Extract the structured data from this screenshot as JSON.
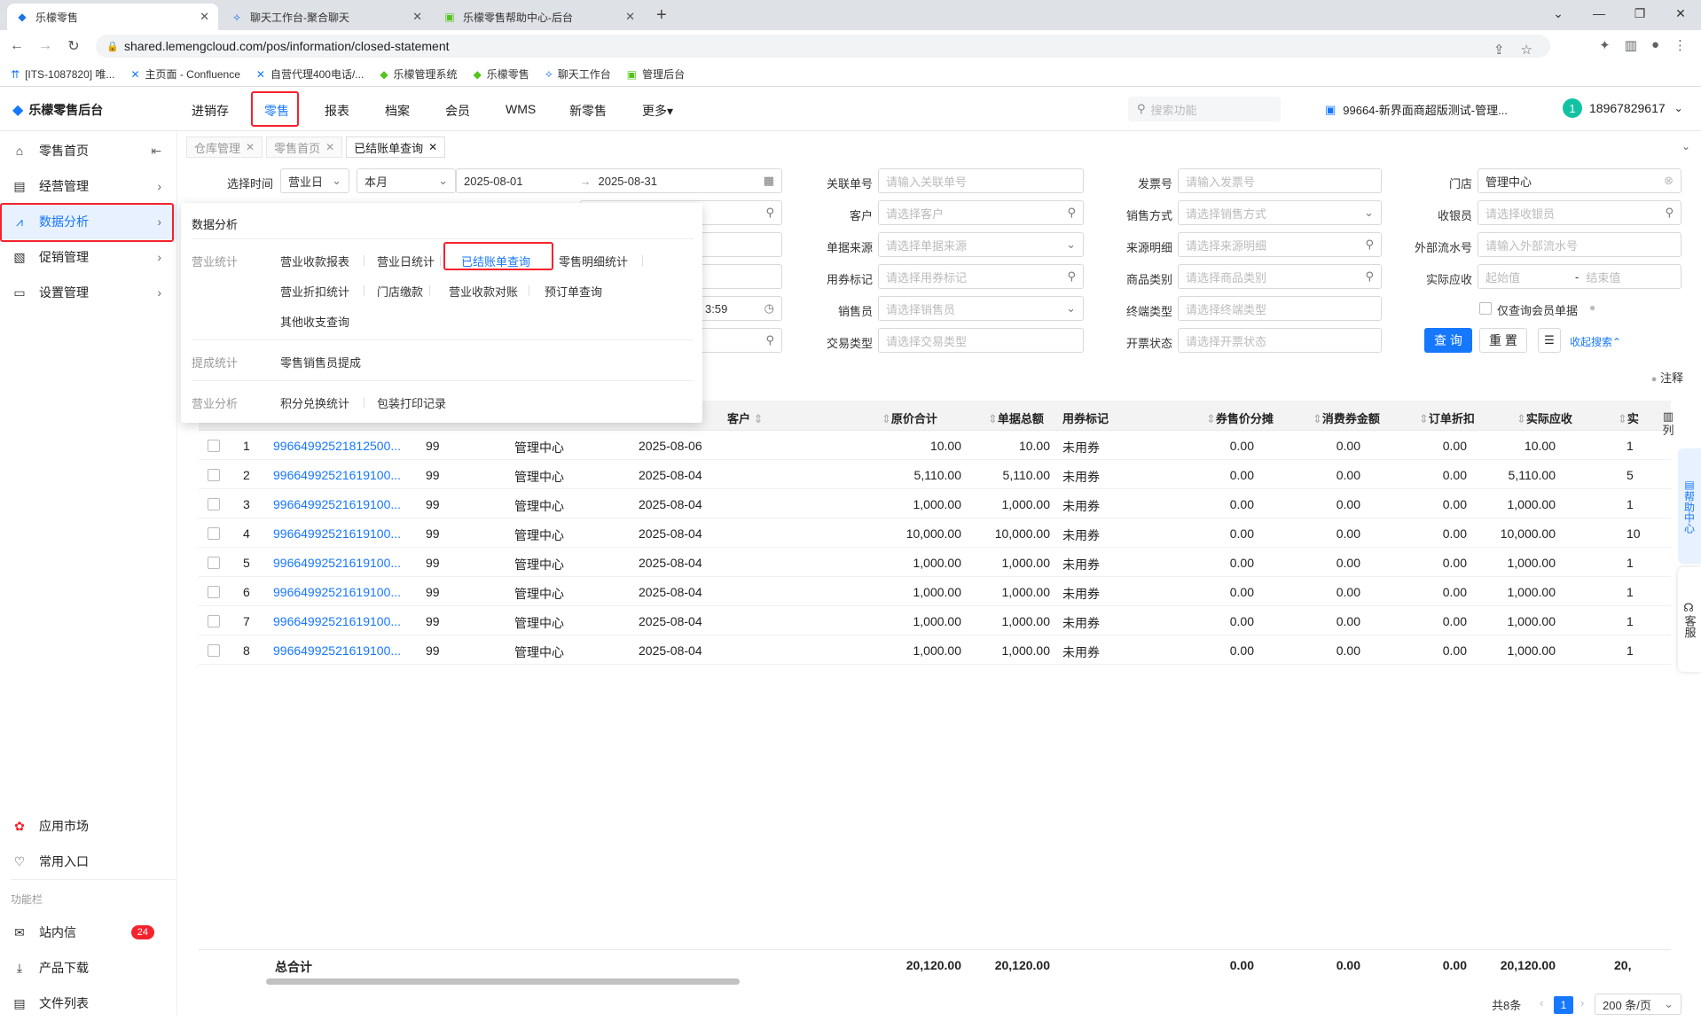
{
  "browser": {
    "tabs": [
      {
        "label": "乐檬零售"
      },
      {
        "label": "聊天工作台-聚合聊天"
      },
      {
        "label": "乐檬零售帮助中心-后台"
      }
    ],
    "url": "shared.lemengcloud.com/pos/information/closed-statement",
    "bookmarks": [
      {
        "label": "[ITS-1087820] 唯..."
      },
      {
        "label": "主页面 - Confluence"
      },
      {
        "label": "自营代理400电话/..."
      },
      {
        "label": "乐檬管理系统"
      },
      {
        "label": "乐檬零售"
      },
      {
        "label": "聊天工作台"
      },
      {
        "label": "管理后台"
      }
    ]
  },
  "header": {
    "logo": "乐檬零售后台",
    "menu": [
      {
        "label": "进销存"
      },
      {
        "label": "零售"
      },
      {
        "label": "报表"
      },
      {
        "label": "档案"
      },
      {
        "label": "会员"
      },
      {
        "label": "WMS"
      },
      {
        "label": "新零售"
      },
      {
        "label": "更多▾"
      }
    ],
    "search_placeholder": "搜索功能",
    "store": "99664-新界面商超版测试-管理...",
    "avatar_text": "1",
    "user": "18967829617"
  },
  "sidebar": {
    "items": [
      {
        "label": "零售首页"
      },
      {
        "label": "经营管理"
      },
      {
        "label": "数据分析"
      },
      {
        "label": "促销管理"
      },
      {
        "label": "设置管理"
      }
    ],
    "bottom": [
      {
        "label": "应用市场"
      },
      {
        "label": "常用入口"
      }
    ],
    "func_label": "功能栏",
    "func": [
      {
        "label": "站内信"
      },
      {
        "label": "产品下载"
      },
      {
        "label": "文件列表"
      }
    ],
    "badge": "24"
  },
  "pagetabs": [
    {
      "label": "仓库管理"
    },
    {
      "label": "零售首页"
    },
    {
      "label": "已结账单查询"
    }
  ],
  "filters": {
    "select_time": "选择时间",
    "biz_day": "营业日",
    "period": "本月",
    "date_start": "2025-08-01",
    "date_end": "2025-08-31",
    "time_partial": "3:59",
    "labels": {
      "rel_no": "关联单号",
      "invoice": "发票号",
      "store": "门店",
      "customer": "客户",
      "sale_mode": "销售方式",
      "cashier": "收银员",
      "source": "单据来源",
      "source_detail": "来源明细",
      "ext_serial": "外部流水号",
      "coupon": "用券标记",
      "category": "商品类别",
      "receivable": "实际应收",
      "salesman": "销售员",
      "terminal": "终端类型",
      "trade_type": "交易类型",
      "invoice_status": "开票状态"
    },
    "placeholders": {
      "rel_no": "请输入关联单号",
      "invoice": "请输入发票号",
      "customer": "请选择客户",
      "sale_mode": "请选择销售方式",
      "cashier": "请选择收银员",
      "source": "请选择单据来源",
      "source_detail": "请选择来源明细",
      "ext_serial": "请输入外部流水号",
      "coupon": "请选择用券标记",
      "category": "请选择商品类别",
      "min": "起始值",
      "max": "结束值",
      "salesman": "请选择销售员",
      "terminal": "请选择终端类型",
      "trade_type": "请选择交易类型",
      "invoice_status": "请选择开票状态"
    },
    "store_value": "管理中心",
    "member_only": "仅查询会员单据",
    "query": "查 询",
    "reset": "重 置",
    "collapse": "收起搜索",
    "note": "注释"
  },
  "dropdown": {
    "title": "数据分析",
    "sec1": "营业统计",
    "links1": [
      "营业收款报表",
      "营业日统计",
      "已结账单查询",
      "零售明细统计",
      "营业折扣统计",
      "门店缴款",
      "营业收款对账",
      "预订单查询",
      "其他收支查询"
    ],
    "sec2": "提成统计",
    "links2": [
      "零售销售员提成"
    ],
    "sec3": "营业分析",
    "links3": [
      "积分兑换统计",
      "包装打印记录"
    ]
  },
  "table": {
    "headers": [
      "客户",
      "原价合计",
      "单据总额",
      "用券标记",
      "券售价分摊",
      "消费券金额",
      "订单折扣",
      "实际应收",
      "实"
    ],
    "col_btn": "列",
    "rows": [
      {
        "idx": "1",
        "no": "99664992521812500...",
        "c3": "99",
        "store": "管理中心",
        "date": "2025-08-06",
        "orig": "10.00",
        "total": "10.00",
        "coupon": "未用券",
        "share": "0.00",
        "voucher": "0.00",
        "disc": "0.00",
        "recv": "10.00",
        "last": "1"
      },
      {
        "idx": "2",
        "no": "99664992521619100...",
        "c3": "99",
        "store": "管理中心",
        "date": "2025-08-04",
        "orig": "5,110.00",
        "total": "5,110.00",
        "coupon": "未用券",
        "share": "0.00",
        "voucher": "0.00",
        "disc": "0.00",
        "recv": "5,110.00",
        "last": "5"
      },
      {
        "idx": "3",
        "no": "99664992521619100...",
        "c3": "99",
        "store": "管理中心",
        "date": "2025-08-04",
        "orig": "1,000.00",
        "total": "1,000.00",
        "coupon": "未用券",
        "share": "0.00",
        "voucher": "0.00",
        "disc": "0.00",
        "recv": "1,000.00",
        "last": "1"
      },
      {
        "idx": "4",
        "no": "99664992521619100...",
        "c3": "99",
        "store": "管理中心",
        "date": "2025-08-04",
        "orig": "10,000.00",
        "total": "10,000.00",
        "coupon": "未用券",
        "share": "0.00",
        "voucher": "0.00",
        "disc": "0.00",
        "recv": "10,000.00",
        "last": "10"
      },
      {
        "idx": "5",
        "no": "99664992521619100...",
        "c3": "99",
        "store": "管理中心",
        "date": "2025-08-04",
        "orig": "1,000.00",
        "total": "1,000.00",
        "coupon": "未用券",
        "share": "0.00",
        "voucher": "0.00",
        "disc": "0.00",
        "recv": "1,000.00",
        "last": "1"
      },
      {
        "idx": "6",
        "no": "99664992521619100...",
        "c3": "99",
        "store": "管理中心",
        "date": "2025-08-04",
        "orig": "1,000.00",
        "total": "1,000.00",
        "coupon": "未用券",
        "share": "0.00",
        "voucher": "0.00",
        "disc": "0.00",
        "recv": "1,000.00",
        "last": "1"
      },
      {
        "idx": "7",
        "no": "99664992521619100...",
        "c3": "99",
        "store": "管理中心",
        "date": "2025-08-04",
        "orig": "1,000.00",
        "total": "1,000.00",
        "coupon": "未用券",
        "share": "0.00",
        "voucher": "0.00",
        "disc": "0.00",
        "recv": "1,000.00",
        "last": "1"
      },
      {
        "idx": "8",
        "no": "99664992521619100...",
        "c3": "99",
        "store": "管理中心",
        "date": "2025-08-04",
        "orig": "1,000.00",
        "total": "1,000.00",
        "coupon": "未用券",
        "share": "0.00",
        "voucher": "0.00",
        "disc": "0.00",
        "recv": "1,000.00",
        "last": "1"
      }
    ],
    "total": {
      "label": "总合计",
      "orig": "20,120.00",
      "total": "20,120.00",
      "share": "0.00",
      "voucher": "0.00",
      "disc": "0.00",
      "recv": "20,120.00",
      "last": "20,"
    }
  },
  "pager": {
    "count": "共8条",
    "page": "1",
    "size": "200 条/页"
  },
  "rails": {
    "help": "帮助中心",
    "service": "客服"
  },
  "watermark": "18967829617"
}
